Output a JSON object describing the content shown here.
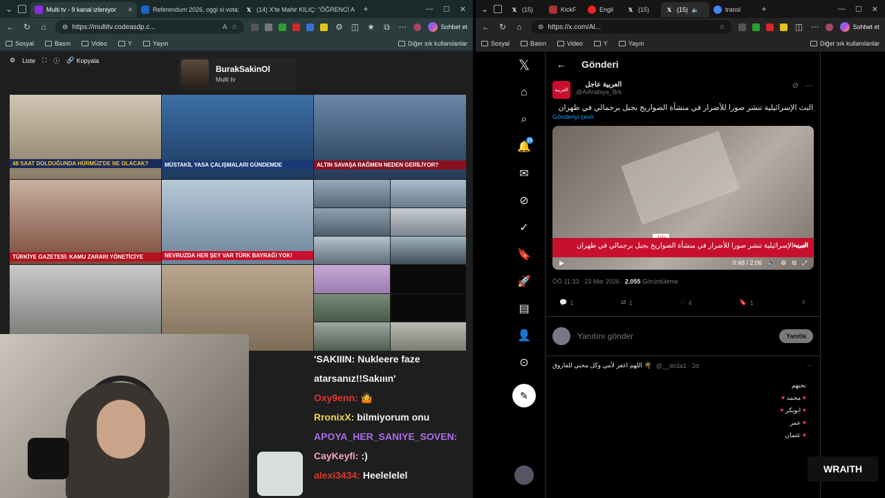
{
  "left": {
    "tabs": [
      {
        "title": "Multi tv - 9 kanal izleniyor",
        "active": true,
        "color": "#8a2be2"
      },
      {
        "title": "Referendum 2026, oggi si vota: le",
        "active": false,
        "color": "#1f63c4"
      },
      {
        "title": "(14) X'te Mahir KILIÇ: \"ÖĞRENCİ A",
        "active": false,
        "color": "#000000"
      }
    ],
    "url": "https://multitv.codeasdp.c...",
    "copilot": "Sohbet et",
    "bookmarks": [
      "Sosyal",
      "Basın",
      "Video",
      "Y",
      "Yayın"
    ],
    "other_bookmarks": "Diğer sık kullanılanlar",
    "multitv": {
      "toolbar": {
        "liste": "Liste",
        "kopyala": "Kopyala"
      },
      "channel": {
        "name": "BurakSakinOl",
        "subtitle": "Multi tv"
      },
      "cells": [
        {
          "caption": "48 SAAT DOLDUĞUNDA HÜRMÜZ'DE NE OLACAK?",
          "bg": "#c8b59a"
        },
        {
          "caption": "MÜSTAKİL YASA ÇALIŞMALARI GÜNDEMDE",
          "bg": "#2b5a8a"
        },
        {
          "caption": "ALTIN SAVAŞA RAĞMEN NEDEN GERİLİYOR?",
          "bg": "#2f4a6a"
        },
        {
          "caption": "TÜRKİYE GAZETESİ: KAMU ZARARI YÖNETİCİYE",
          "bg": "#b06a5a"
        },
        {
          "caption": "NEVRUZDA HER ŞEY VAR TÜRK BAYRAĞI YOK!",
          "bg": "#9ab4c9"
        }
      ]
    },
    "chat": [
      {
        "user": "",
        "msg": "'SAKIIIN: Nukleere faze",
        "color": "#eeeeee"
      },
      {
        "user": "",
        "msg": "atarsanız!!Sakııın'",
        "color": "#eeeeee"
      },
      {
        "user": "Oxy9enn:",
        "msg": "🤷",
        "color": "#e0352b"
      },
      {
        "user": "RronixX:",
        "msg": "bilmiyorum onu",
        "color": "#f0d84a"
      },
      {
        "user": "APOYA_HER_SANIYE_SOVEN:",
        "msg": "",
        "color": "#b16cf0"
      },
      {
        "user": "CayKeyfi:",
        "msg": ":)",
        "color": "#f6a6c1"
      },
      {
        "user": "alexi3434:",
        "msg": "Heelelelel",
        "color": "#e0352b"
      }
    ]
  },
  "right": {
    "tabs": [
      "(15)",
      "KickF",
      "Engli",
      "(15)",
      "(15)",
      "transl"
    ],
    "url": "https://x.com/Al...",
    "copilot": "Sohbet et",
    "bookmarks": [
      "Sosyal",
      "Basın",
      "Video",
      "Y",
      "Yayın"
    ],
    "other_bookmarks": "Diğer sık kullanılanlar",
    "x": {
      "header": "Gönderi",
      "notif_count": "15",
      "author": {
        "name": "العربية عاجل",
        "handle": "@AlArabiya_Brk",
        "logo": "العربية"
      },
      "text": "البث الإسرائيلية تنشر صورا للأضرار في منشأة الصواريخ بجبل برجمالي في طهران",
      "translate": "Gönderiyi çevir",
      "video": {
        "ticker": "البث الإسرائيلية تنشر صورا للأضرار في منشأة الصواريخ بجبل برجمالي في طهران",
        "label": "عاجل",
        "brand": "العربية",
        "time": "0:48 / 2:06"
      },
      "meta": {
        "time": "ÖÖ 11:33 · 23 Mar 2026 ·",
        "views": "2.055",
        "views_label": "Görüntüleme"
      },
      "actions": {
        "reply": "1",
        "repost": "1",
        "like": "4",
        "bookmark": "1"
      },
      "reply": {
        "placeholder": "Yanıtını gönder",
        "button": "Yanıtla"
      },
      "comment": {
        "name": "اللهم اغفر لأمي وكل محبي للفاروق 🌴",
        "handle": "@__do3a1 · 2d",
        "lines": [
          "نحبهم",
          "محمد",
          "ابوبكر",
          "عمر",
          "عثمان"
        ]
      }
    }
  },
  "overlay": {
    "brand": "WRAITH"
  }
}
